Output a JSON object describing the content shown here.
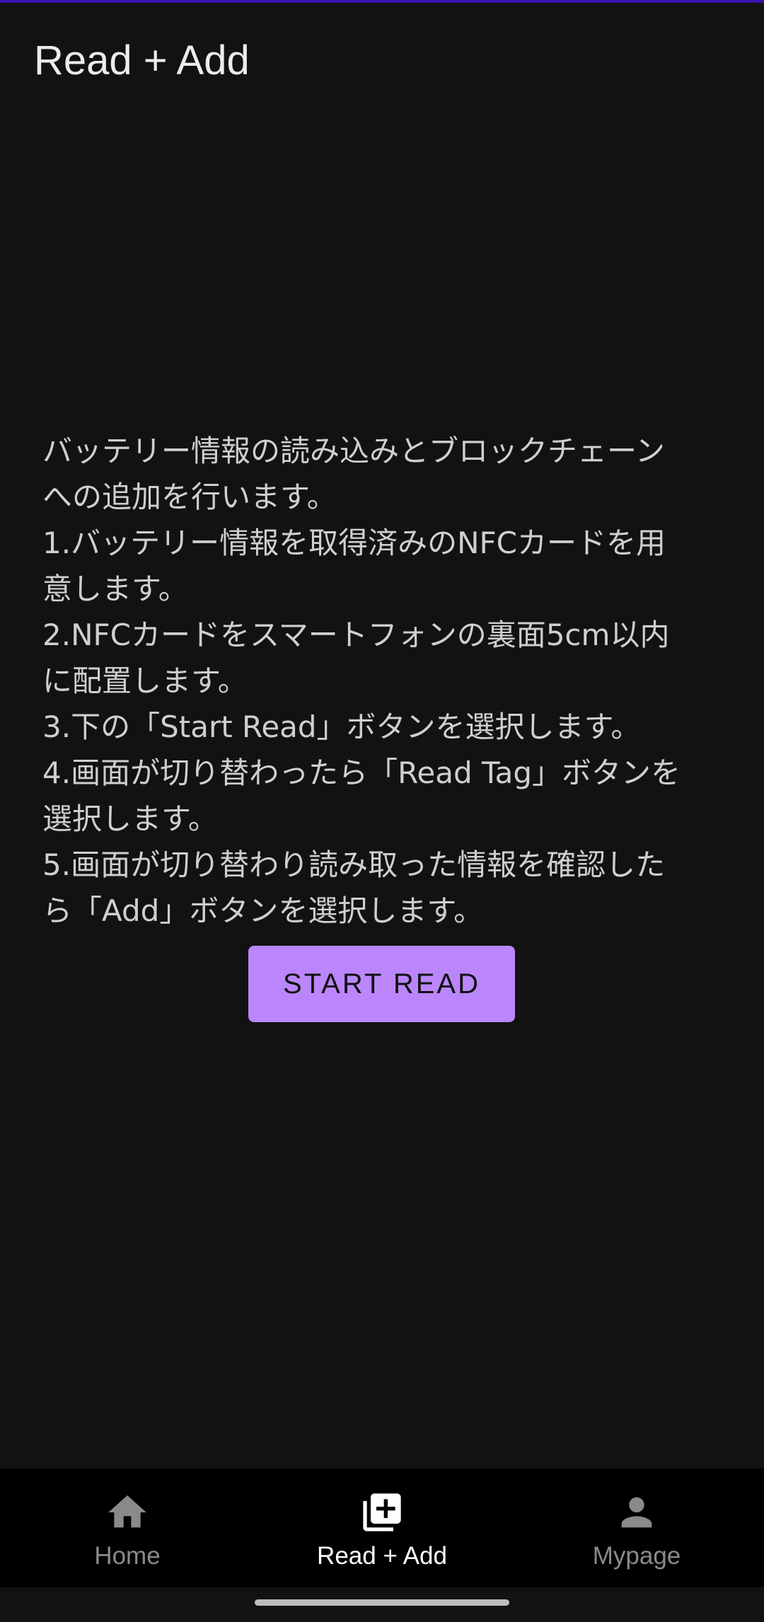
{
  "app_bar": {
    "title": "Read + Add"
  },
  "instructions": {
    "lines": [
      "バッテリー情報の読み込みとブロックチェーン",
      "への追加を行います。",
      "1.バッテリー情報を取得済みのNFCカードを用",
      "意します。",
      "2.NFCカードをスマートフォンの裏面5cm以内",
      "に配置します。",
      "3.下の「Start Read」ボタンを選択します。",
      "4.画面が切り替わったら「Read Tag」ボタンを",
      "選択します。",
      "5.画面が切り替わり読み取った情報を確認した",
      "ら「Add」ボタンを選択します。"
    ]
  },
  "start_button": {
    "label": "START READ"
  },
  "bottom_nav": {
    "items": [
      {
        "label": "Home",
        "icon": "home-icon",
        "active": false
      },
      {
        "label": "Read + Add",
        "icon": "library-add-icon",
        "active": true
      },
      {
        "label": "Mypage",
        "icon": "person-icon",
        "active": false
      }
    ]
  },
  "colors": {
    "background": "#121212",
    "accent": "#bb86fc",
    "status_strip": "#3a11a8",
    "nav_background": "#000000"
  }
}
